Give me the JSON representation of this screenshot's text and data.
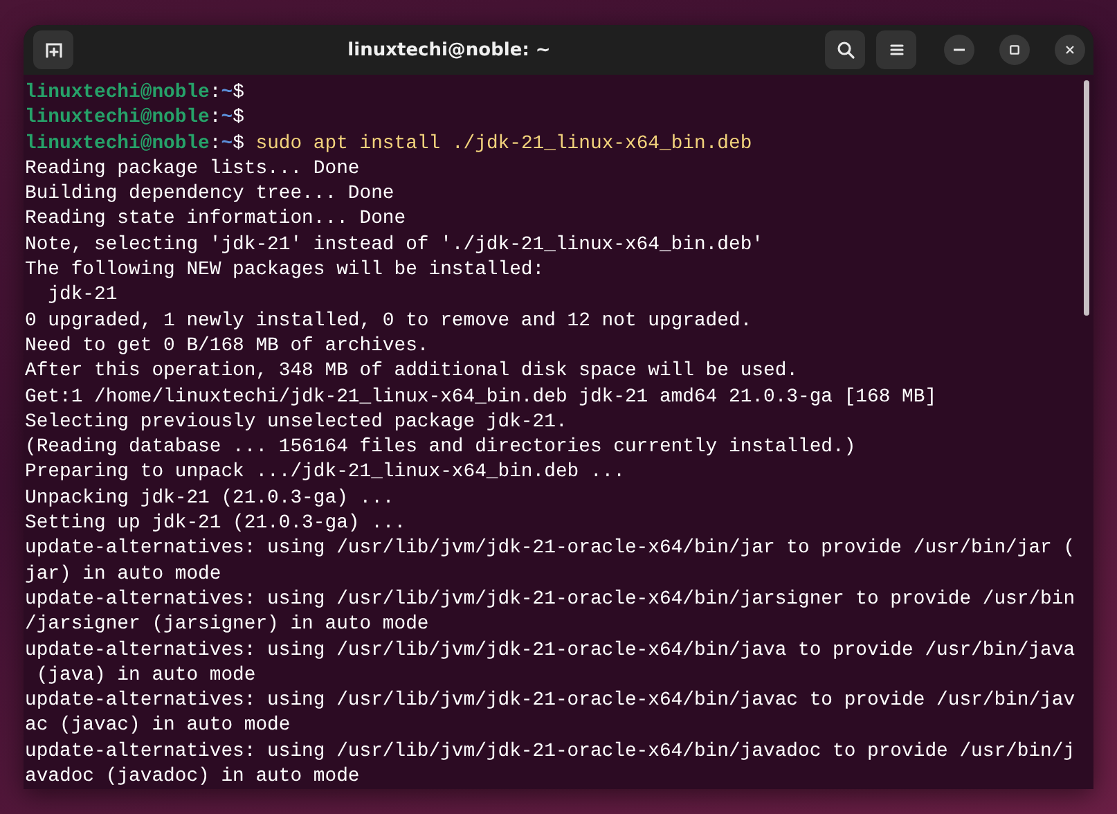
{
  "window": {
    "title": "linuxtechi@noble: ~"
  },
  "terminal": {
    "lines": [
      {
        "kind": "prompt",
        "user_host": "linuxtechi@noble",
        "separator": ":",
        "path": "~",
        "symbol": "$"
      },
      {
        "kind": "prompt",
        "user_host": "linuxtechi@noble",
        "separator": ":",
        "path": "~",
        "symbol": "$"
      },
      {
        "kind": "prompt",
        "user_host": "linuxtechi@noble",
        "separator": ":",
        "path": "~",
        "symbol": "$",
        "command": "sudo apt install ./jdk-21_linux-x64_bin.deb"
      },
      {
        "kind": "output",
        "text": "Reading package lists... Done"
      },
      {
        "kind": "output",
        "text": "Building dependency tree... Done"
      },
      {
        "kind": "output",
        "text": "Reading state information... Done"
      },
      {
        "kind": "output",
        "text": "Note, selecting 'jdk-21' instead of './jdk-21_linux-x64_bin.deb'"
      },
      {
        "kind": "output",
        "text": "The following NEW packages will be installed:"
      },
      {
        "kind": "output",
        "text": "  jdk-21"
      },
      {
        "kind": "output",
        "text": "0 upgraded, 1 newly installed, 0 to remove and 12 not upgraded."
      },
      {
        "kind": "output",
        "text": "Need to get 0 B/168 MB of archives."
      },
      {
        "kind": "output",
        "text": "After this operation, 348 MB of additional disk space will be used."
      },
      {
        "kind": "output",
        "text": "Get:1 /home/linuxtechi/jdk-21_linux-x64_bin.deb jdk-21 amd64 21.0.3-ga [168 MB]"
      },
      {
        "kind": "output",
        "text": "Selecting previously unselected package jdk-21."
      },
      {
        "kind": "output",
        "text": "(Reading database ... 156164 files and directories currently installed.)"
      },
      {
        "kind": "output",
        "text": "Preparing to unpack .../jdk-21_linux-x64_bin.deb ..."
      },
      {
        "kind": "output",
        "text": "Unpacking jdk-21 (21.0.3-ga) ..."
      },
      {
        "kind": "output",
        "text": "Setting up jdk-21 (21.0.3-ga) ..."
      },
      {
        "kind": "output",
        "text": "update-alternatives: using /usr/lib/jvm/jdk-21-oracle-x64/bin/jar to provide /usr/bin/jar ("
      },
      {
        "kind": "output",
        "text": "jar) in auto mode"
      },
      {
        "kind": "output",
        "text": "update-alternatives: using /usr/lib/jvm/jdk-21-oracle-x64/bin/jarsigner to provide /usr/bin"
      },
      {
        "kind": "output",
        "text": "/jarsigner (jarsigner) in auto mode"
      },
      {
        "kind": "output",
        "text": "update-alternatives: using /usr/lib/jvm/jdk-21-oracle-x64/bin/java to provide /usr/bin/java"
      },
      {
        "kind": "output",
        "text": " (java) in auto mode"
      },
      {
        "kind": "output",
        "text": "update-alternatives: using /usr/lib/jvm/jdk-21-oracle-x64/bin/javac to provide /usr/bin/jav"
      },
      {
        "kind": "output",
        "text": "ac (javac) in auto mode"
      },
      {
        "kind": "output",
        "text": "update-alternatives: using /usr/lib/jvm/jdk-21-oracle-x64/bin/javadoc to provide /usr/bin/j"
      },
      {
        "kind": "output",
        "text": "avadoc (javadoc) in auto mode"
      }
    ]
  }
}
